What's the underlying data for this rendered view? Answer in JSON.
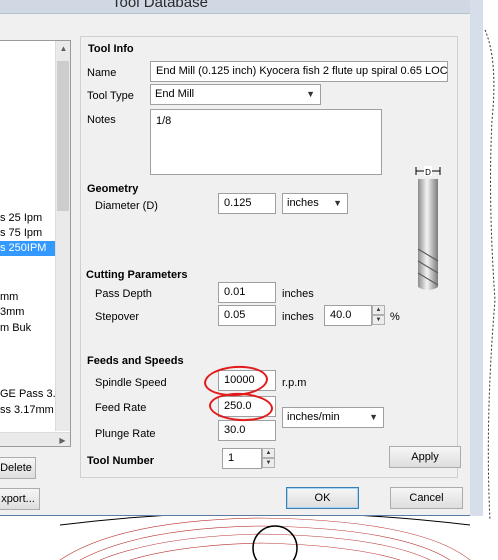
{
  "window": {
    "title": "Tool Database"
  },
  "tool_list": {
    "items": [
      {
        "label": "s 25 Ipm",
        "selected": false
      },
      {
        "label": "s 75 Ipm",
        "selected": false
      },
      {
        "label": "s 250IPM",
        "selected": true
      },
      {
        "label": "mm",
        "selected": false
      },
      {
        "label": "3mm",
        "selected": false
      },
      {
        "label": "m Buk",
        "selected": false
      },
      {
        "label": "GE  Pass 3.",
        "selected": false
      },
      {
        "label": "ss 3.17mm",
        "selected": false
      }
    ]
  },
  "buttons": {
    "delete": "Delete",
    "export": "xport...",
    "apply": "Apply",
    "ok": "OK",
    "cancel": "Cancel"
  },
  "tool_info": {
    "section_title": "Tool Info",
    "name_label": "Name",
    "name_value": "End Mill (0.125 inch) Kyocera fish 2 flute up spiral  0.65 LOC",
    "tool_type_label": "Tool Type",
    "tool_type_value": "End Mill",
    "notes_label": "Notes",
    "notes_value": "1/8"
  },
  "geometry": {
    "section_title": "Geometry",
    "diameter_label": "Diameter (D)",
    "diameter_value": "0.125",
    "units_value": "inches",
    "diagram_label": "D"
  },
  "cutting": {
    "section_title": "Cutting Parameters",
    "pass_depth_label": "Pass Depth",
    "pass_depth_value": "0.01",
    "pass_depth_units": "inches",
    "stepover_label": "Stepover",
    "stepover_value": "0.05",
    "stepover_units": "inches",
    "stepover_percent": "40.0",
    "percent_sign": "%"
  },
  "feeds": {
    "section_title": "Feeds and Speeds",
    "spindle_label": "Spindle Speed",
    "spindle_value": "10000",
    "spindle_units": "r.p.m",
    "feed_label": "Feed Rate",
    "feed_value": "250.0",
    "feed_units": "inches/min",
    "plunge_label": "Plunge Rate",
    "plunge_value": "30.0"
  },
  "tool_number": {
    "label": "Tool Number",
    "value": "1"
  },
  "colors": {
    "annotation": "#e21a1a",
    "selection": "#3399ff",
    "default_button_border": "#3c7fb1"
  }
}
